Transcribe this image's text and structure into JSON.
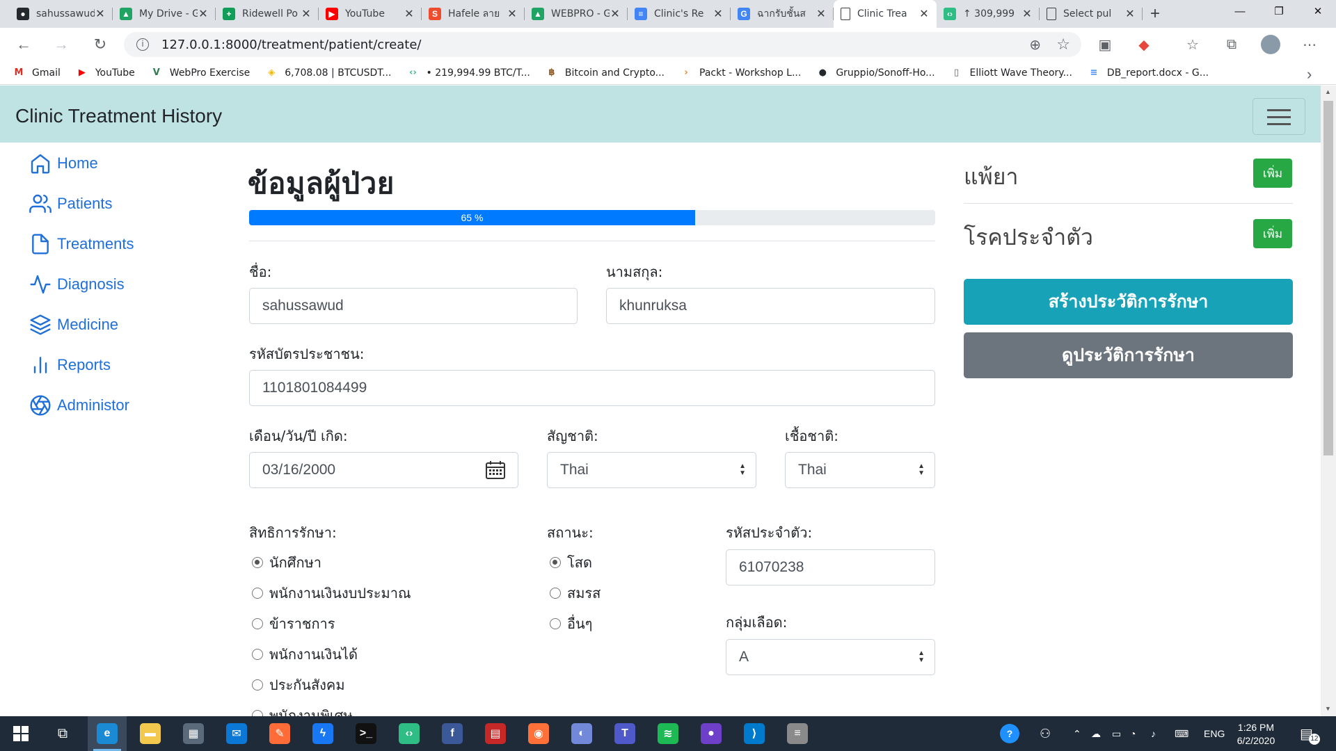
{
  "browser": {
    "tabs": [
      {
        "title": "sahussawud",
        "icon": "github-icon",
        "color": "#24292e",
        "glyph": "●"
      },
      {
        "title": "My Drive - Google Drive",
        "icon": "google-drive-icon",
        "color": "#1fa463",
        "glyph": "▲"
      },
      {
        "title": "Ridewell Po",
        "icon": "sheets-icon",
        "color": "#0f9d58",
        "glyph": "+"
      },
      {
        "title": "YouTube",
        "icon": "youtube-icon",
        "color": "#ff0000",
        "glyph": "▶"
      },
      {
        "title": "Hafele ลาย",
        "icon": "shop-icon",
        "color": "#ee4d2d",
        "glyph": "S"
      },
      {
        "title": "WEBPRO - Google Drive",
        "icon": "google-drive-icon",
        "color": "#1fa463",
        "glyph": "▲"
      },
      {
        "title": "Clinic's Re",
        "icon": "docs-icon",
        "color": "#4285f4",
        "glyph": "≡"
      },
      {
        "title": "ฉากรับชั้นส",
        "icon": "google-icon",
        "color": "#4285f4",
        "glyph": "G"
      },
      {
        "title": "Clinic Trea",
        "icon": "page-icon",
        "color": "#ffffff",
        "glyph": "",
        "active": true
      },
      {
        "title": "↑ 309,999",
        "icon": "exchange-icon",
        "color": "#2ebd85",
        "glyph": "‹›"
      },
      {
        "title": "Select pul",
        "icon": "page-icon",
        "color": "#ffffff",
        "glyph": ""
      }
    ],
    "new_tab": "+",
    "url": "127.0.0.1:8000/treatment/patient/create/",
    "bookmarks": [
      {
        "label": "Gmail",
        "icon": "gmail-icon",
        "color": "#d93025",
        "glyph": "M"
      },
      {
        "label": "YouTube",
        "icon": "youtube-icon",
        "color": "#ff0000",
        "glyph": "▶"
      },
      {
        "label": "WebPro Exercise",
        "icon": "vue-icon",
        "color": "#2f7d4f",
        "glyph": "V"
      },
      {
        "label": "6,708.08 | BTCUSDT...",
        "icon": "binance-icon",
        "color": "#f0b90b",
        "glyph": "◈"
      },
      {
        "label": "• 219,994.99 BTC/T...",
        "icon": "exchange-icon",
        "color": "#2ebd85",
        "glyph": "‹›"
      },
      {
        "label": "Bitcoin and Crypto...",
        "icon": "bitcoin-icon",
        "color": "#8a5a2b",
        "glyph": "฿"
      },
      {
        "label": "Packt - Workshop L...",
        "icon": "packt-icon",
        "color": "#f47b20",
        "glyph": "›"
      },
      {
        "label": "Gruppio/Sonoff-Ho...",
        "icon": "github-icon",
        "color": "#24292e",
        "glyph": "●"
      },
      {
        "label": "Elliott Wave Theory...",
        "icon": "page-icon",
        "color": "#5f6368",
        "glyph": "▯"
      },
      {
        "label": "DB_report.docx - G...",
        "icon": "docs-icon",
        "color": "#4285f4",
        "glyph": "≡"
      }
    ]
  },
  "app": {
    "brand": "Clinic Treatment History",
    "accent": "#1e6fd9",
    "navbar_color": "#bfe3e3",
    "sidebar": [
      {
        "label": "Home",
        "icon": "home-icon"
      },
      {
        "label": "Patients",
        "icon": "users-icon"
      },
      {
        "label": "Treatments",
        "icon": "file-icon"
      },
      {
        "label": "Diagnosis",
        "icon": "activity-icon"
      },
      {
        "label": "Medicine",
        "icon": "layers-icon"
      },
      {
        "label": "Reports",
        "icon": "bar-chart-icon"
      },
      {
        "label": "Administor",
        "icon": "aperture-icon"
      }
    ]
  },
  "form": {
    "title": "ข้อมูลผู้ป่วย",
    "progress": {
      "value": 65,
      "label": "65 %"
    },
    "first_name": {
      "label": "ชื่อ:",
      "value": "sahussawud"
    },
    "last_name": {
      "label": "นามสกุล:",
      "value": "khunruksa"
    },
    "citizen_id": {
      "label": "รหัสบัตรประชาชน:",
      "value": "1101801084499"
    },
    "birth_date": {
      "label": "เดือน/วัน/ปี เกิด:",
      "value": "03/16/2000"
    },
    "nationality": {
      "label": "สัญชาติ:",
      "value": "Thai"
    },
    "ethnicity": {
      "label": "เชื้อชาติ:",
      "value": "Thai"
    },
    "rights": {
      "label": "สิทธิการรักษา:",
      "options": [
        "นักศึกษา",
        "พนักงานเงินงบประมาณ",
        "ข้าราชการ",
        "พนักงานเงินได้",
        "ประกันสังคม",
        "พนักงานพิเศษ"
      ],
      "selected": 0
    },
    "status": {
      "label": "สถานะ:",
      "options": [
        "โสด",
        "สมรส",
        "อื่นๆ"
      ],
      "selected": 0
    },
    "personal_code": {
      "label": "รหัสประจำตัว:",
      "value": "61070238"
    },
    "blood_group": {
      "label": "กลุ่มเลือด:",
      "value": "A"
    }
  },
  "right_panel": {
    "allergy": {
      "title": "แพ้ยา",
      "add_label": "เพิ่ม"
    },
    "chronic": {
      "title": "โรคประจำตัว",
      "add_label": "เพิ่ม"
    },
    "create_history": {
      "label": "สร้างประวัติการรักษา",
      "color": "#17a2b8"
    },
    "view_history": {
      "label": "ดูประวัติการรักษา",
      "color": "#6c757d"
    }
  },
  "taskbar": {
    "apps": [
      {
        "name": "edge-icon",
        "color": "#1a8ad4",
        "glyph": "e",
        "active": true
      },
      {
        "name": "file-explorer-icon",
        "color": "#f2c94c",
        "glyph": "▬"
      },
      {
        "name": "store-icon",
        "color": "#5a6a7a",
        "glyph": "▦"
      },
      {
        "name": "mail-icon",
        "color": "#0a78d4",
        "glyph": "✉"
      },
      {
        "name": "postman-icon",
        "color": "#ff6c37",
        "glyph": "✎"
      },
      {
        "name": "messenger-icon",
        "color": "#1877f2",
        "glyph": "ϟ"
      },
      {
        "name": "terminal-icon",
        "color": "#111111",
        "glyph": ">_"
      },
      {
        "name": "exchange-icon",
        "color": "#2ebd85",
        "glyph": "‹›"
      },
      {
        "name": "facebook-icon",
        "color": "#3b5998",
        "glyph": "f"
      },
      {
        "name": "news-icon",
        "color": "#c62828",
        "glyph": "▤"
      },
      {
        "name": "firefox-icon",
        "color": "#ff7139",
        "glyph": "◉"
      },
      {
        "name": "discord-icon",
        "color": "#7289da",
        "glyph": "◐"
      },
      {
        "name": "teams-icon",
        "color": "#5059c9",
        "glyph": "T"
      },
      {
        "name": "spotify-icon",
        "color": "#1db954",
        "glyph": "≋"
      },
      {
        "name": "github-desktop-icon",
        "color": "#6e40c9",
        "glyph": "●"
      },
      {
        "name": "vscode-icon",
        "color": "#007acc",
        "glyph": "⟩"
      },
      {
        "name": "database-icon",
        "color": "#8a8a8a",
        "glyph": "≡"
      }
    ],
    "language": "ENG",
    "time": "1:26 PM",
    "date": "6/2/2020",
    "notifications": "12"
  }
}
